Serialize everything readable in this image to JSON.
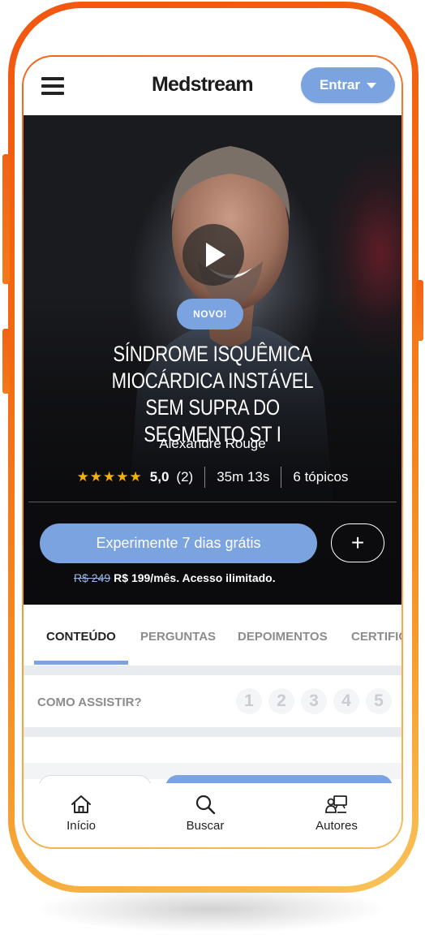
{
  "header": {
    "logo": "Medstream",
    "login_label": "Entrar"
  },
  "course": {
    "badge": "NOVO!",
    "title": "SÍNDROME ISQUÊMICA MIOCÁRDICA INSTÁVEL SEM SUPRA DO SEGMENTO ST I",
    "author": "Alexandre Rouge",
    "stars": "★★★★★",
    "rating": "5,0",
    "reviews": "(2)",
    "duration": "35m 13s",
    "topics": "6 tópicos",
    "trial_button": "Experimente 7 dias grátis",
    "add_button": "+",
    "price_old": "R$ 249",
    "price_new": "R$ 199/mês. Acesso ilimitado."
  },
  "tabs": [
    {
      "label": "CONTEÚDO",
      "active": true
    },
    {
      "label": "PERGUNTAS"
    },
    {
      "label": "DEPOIMENTOS"
    },
    {
      "label": "CERTIFICADO"
    }
  ],
  "how_to_watch": {
    "label": "COMO ASSISTIR?",
    "steps": [
      "1",
      "2",
      "3",
      "4",
      "5"
    ]
  },
  "bottom_nav": [
    {
      "label": "Início",
      "icon": "home-icon"
    },
    {
      "label": "Buscar",
      "icon": "search-icon"
    },
    {
      "label": "Autores",
      "icon": "authors-icon"
    }
  ],
  "colors": {
    "accent": "#7ba3df",
    "frame_start": "#f2560f",
    "frame_end": "#f8c45a",
    "star": "#f5b200"
  }
}
